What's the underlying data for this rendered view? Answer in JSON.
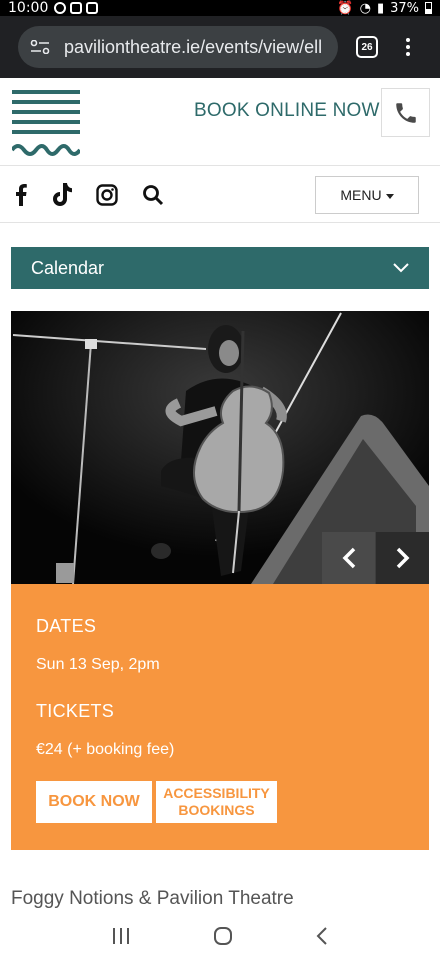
{
  "status_bar": {
    "time": "10:00",
    "battery": "37%"
  },
  "browser": {
    "url": "paviliontheatre.ie/events/view/ell",
    "tab_count": "26"
  },
  "header": {
    "book_online": "BOOK ONLINE NOW"
  },
  "social": {
    "icons": [
      "facebook-icon",
      "tiktok-icon",
      "instagram-icon",
      "search-icon"
    ],
    "menu_label": "MENU"
  },
  "calendar": {
    "label": "Calendar"
  },
  "event": {
    "dates_heading": "DATES",
    "date_value": "Sun 13 Sep, 2pm",
    "tickets_heading": "TICKETS",
    "price": "€24 (+ booking fee)",
    "book_now_label": "BOOK NOW",
    "accessibility_label_line1": "ACCESSIBILITY",
    "accessibility_label_line2": "BOOKINGS"
  },
  "presenter": "Foggy Notions & Pavilion Theatre",
  "colors": {
    "teal": "#2e6a6a",
    "orange": "#f7963f"
  }
}
